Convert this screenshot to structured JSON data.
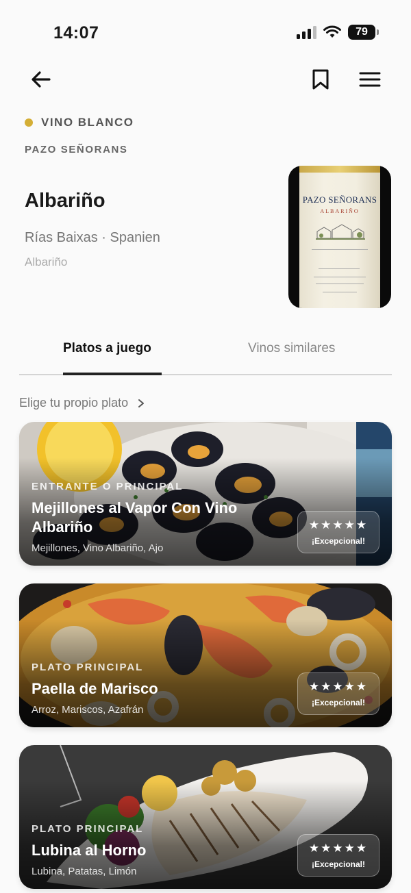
{
  "status_bar": {
    "time": "14:07",
    "battery": "79"
  },
  "wine": {
    "type_label": "VINO BLANCO",
    "type_color": "#d4ae35",
    "producer": "PAZO SEÑORANS",
    "name": "Albariño",
    "region": "Rías Baixas · Spanien",
    "grape": "Albariño",
    "bottle_label": {
      "title": "PAZO SEÑORANS",
      "subtitle": "ALBARIÑO"
    }
  },
  "tabs": [
    {
      "label": "Platos a juego",
      "active": true
    },
    {
      "label": "Vinos similares",
      "active": false
    }
  ],
  "choose_dish": {
    "label": "Elige tu propio plato"
  },
  "dishes": [
    {
      "course": "ENTRANTE O PRINCIPAL",
      "title": "Mejillones al Vapor Con Vino Albariño",
      "ingredients": "Mejillones, Vino Albariño, Ajo",
      "stars": "★★★★★",
      "rating_label": "¡Excepcional!"
    },
    {
      "course": "PLATO PRINCIPAL",
      "title": "Paella de Marisco",
      "ingredients": "Arroz, Mariscos, Azafrán",
      "stars": "★★★★★",
      "rating_label": "¡Excepcional!"
    },
    {
      "course": "PLATO PRINCIPAL",
      "title": "Lubina al Horno",
      "ingredients": "Lubina, Patatas, Limón",
      "stars": "★★★★★",
      "rating_label": "¡Excepcional!"
    }
  ],
  "icons": {
    "back": "arrow-left-icon",
    "bookmark": "bookmark-icon",
    "menu": "hamburger-menu-icon",
    "chevron": "chevron-right-icon"
  }
}
